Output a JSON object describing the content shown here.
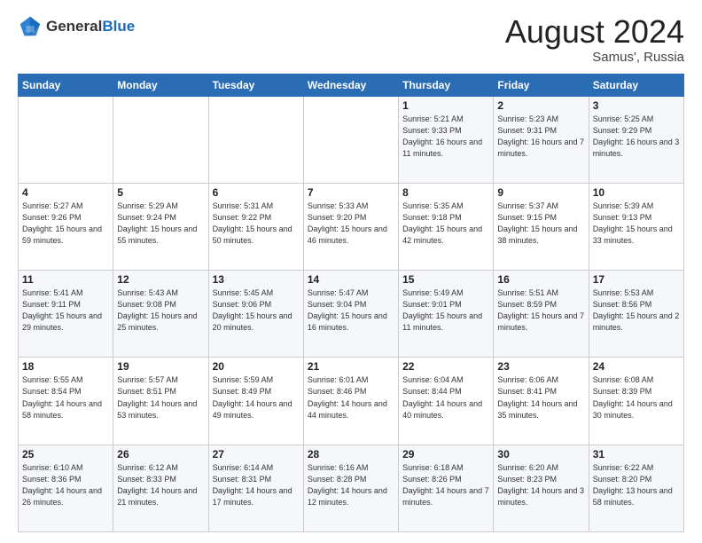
{
  "header": {
    "logo_general": "General",
    "logo_blue": "Blue",
    "month_year": "August 2024",
    "location": "Samus', Russia"
  },
  "weekdays": [
    "Sunday",
    "Monday",
    "Tuesday",
    "Wednesday",
    "Thursday",
    "Friday",
    "Saturday"
  ],
  "weeks": [
    [
      {
        "day": "",
        "sunrise": "",
        "sunset": "",
        "daylight": ""
      },
      {
        "day": "",
        "sunrise": "",
        "sunset": "",
        "daylight": ""
      },
      {
        "day": "",
        "sunrise": "",
        "sunset": "",
        "daylight": ""
      },
      {
        "day": "",
        "sunrise": "",
        "sunset": "",
        "daylight": ""
      },
      {
        "day": "1",
        "sunrise": "Sunrise: 5:21 AM",
        "sunset": "Sunset: 9:33 PM",
        "daylight": "Daylight: 16 hours and 11 minutes."
      },
      {
        "day": "2",
        "sunrise": "Sunrise: 5:23 AM",
        "sunset": "Sunset: 9:31 PM",
        "daylight": "Daylight: 16 hours and 7 minutes."
      },
      {
        "day": "3",
        "sunrise": "Sunrise: 5:25 AM",
        "sunset": "Sunset: 9:29 PM",
        "daylight": "Daylight: 16 hours and 3 minutes."
      }
    ],
    [
      {
        "day": "4",
        "sunrise": "Sunrise: 5:27 AM",
        "sunset": "Sunset: 9:26 PM",
        "daylight": "Daylight: 15 hours and 59 minutes."
      },
      {
        "day": "5",
        "sunrise": "Sunrise: 5:29 AM",
        "sunset": "Sunset: 9:24 PM",
        "daylight": "Daylight: 15 hours and 55 minutes."
      },
      {
        "day": "6",
        "sunrise": "Sunrise: 5:31 AM",
        "sunset": "Sunset: 9:22 PM",
        "daylight": "Daylight: 15 hours and 50 minutes."
      },
      {
        "day": "7",
        "sunrise": "Sunrise: 5:33 AM",
        "sunset": "Sunset: 9:20 PM",
        "daylight": "Daylight: 15 hours and 46 minutes."
      },
      {
        "day": "8",
        "sunrise": "Sunrise: 5:35 AM",
        "sunset": "Sunset: 9:18 PM",
        "daylight": "Daylight: 15 hours and 42 minutes."
      },
      {
        "day": "9",
        "sunrise": "Sunrise: 5:37 AM",
        "sunset": "Sunset: 9:15 PM",
        "daylight": "Daylight: 15 hours and 38 minutes."
      },
      {
        "day": "10",
        "sunrise": "Sunrise: 5:39 AM",
        "sunset": "Sunset: 9:13 PM",
        "daylight": "Daylight: 15 hours and 33 minutes."
      }
    ],
    [
      {
        "day": "11",
        "sunrise": "Sunrise: 5:41 AM",
        "sunset": "Sunset: 9:11 PM",
        "daylight": "Daylight: 15 hours and 29 minutes."
      },
      {
        "day": "12",
        "sunrise": "Sunrise: 5:43 AM",
        "sunset": "Sunset: 9:08 PM",
        "daylight": "Daylight: 15 hours and 25 minutes."
      },
      {
        "day": "13",
        "sunrise": "Sunrise: 5:45 AM",
        "sunset": "Sunset: 9:06 PM",
        "daylight": "Daylight: 15 hours and 20 minutes."
      },
      {
        "day": "14",
        "sunrise": "Sunrise: 5:47 AM",
        "sunset": "Sunset: 9:04 PM",
        "daylight": "Daylight: 15 hours and 16 minutes."
      },
      {
        "day": "15",
        "sunrise": "Sunrise: 5:49 AM",
        "sunset": "Sunset: 9:01 PM",
        "daylight": "Daylight: 15 hours and 11 minutes."
      },
      {
        "day": "16",
        "sunrise": "Sunrise: 5:51 AM",
        "sunset": "Sunset: 8:59 PM",
        "daylight": "Daylight: 15 hours and 7 minutes."
      },
      {
        "day": "17",
        "sunrise": "Sunrise: 5:53 AM",
        "sunset": "Sunset: 8:56 PM",
        "daylight": "Daylight: 15 hours and 2 minutes."
      }
    ],
    [
      {
        "day": "18",
        "sunrise": "Sunrise: 5:55 AM",
        "sunset": "Sunset: 8:54 PM",
        "daylight": "Daylight: 14 hours and 58 minutes."
      },
      {
        "day": "19",
        "sunrise": "Sunrise: 5:57 AM",
        "sunset": "Sunset: 8:51 PM",
        "daylight": "Daylight: 14 hours and 53 minutes."
      },
      {
        "day": "20",
        "sunrise": "Sunrise: 5:59 AM",
        "sunset": "Sunset: 8:49 PM",
        "daylight": "Daylight: 14 hours and 49 minutes."
      },
      {
        "day": "21",
        "sunrise": "Sunrise: 6:01 AM",
        "sunset": "Sunset: 8:46 PM",
        "daylight": "Daylight: 14 hours and 44 minutes."
      },
      {
        "day": "22",
        "sunrise": "Sunrise: 6:04 AM",
        "sunset": "Sunset: 8:44 PM",
        "daylight": "Daylight: 14 hours and 40 minutes."
      },
      {
        "day": "23",
        "sunrise": "Sunrise: 6:06 AM",
        "sunset": "Sunset: 8:41 PM",
        "daylight": "Daylight: 14 hours and 35 minutes."
      },
      {
        "day": "24",
        "sunrise": "Sunrise: 6:08 AM",
        "sunset": "Sunset: 8:39 PM",
        "daylight": "Daylight: 14 hours and 30 minutes."
      }
    ],
    [
      {
        "day": "25",
        "sunrise": "Sunrise: 6:10 AM",
        "sunset": "Sunset: 8:36 PM",
        "daylight": "Daylight: 14 hours and 26 minutes."
      },
      {
        "day": "26",
        "sunrise": "Sunrise: 6:12 AM",
        "sunset": "Sunset: 8:33 PM",
        "daylight": "Daylight: 14 hours and 21 minutes."
      },
      {
        "day": "27",
        "sunrise": "Sunrise: 6:14 AM",
        "sunset": "Sunset: 8:31 PM",
        "daylight": "Daylight: 14 hours and 17 minutes."
      },
      {
        "day": "28",
        "sunrise": "Sunrise: 6:16 AM",
        "sunset": "Sunset: 8:28 PM",
        "daylight": "Daylight: 14 hours and 12 minutes."
      },
      {
        "day": "29",
        "sunrise": "Sunrise: 6:18 AM",
        "sunset": "Sunset: 8:26 PM",
        "daylight": "Daylight: 14 hours and 7 minutes."
      },
      {
        "day": "30",
        "sunrise": "Sunrise: 6:20 AM",
        "sunset": "Sunset: 8:23 PM",
        "daylight": "Daylight: 14 hours and 3 minutes."
      },
      {
        "day": "31",
        "sunrise": "Sunrise: 6:22 AM",
        "sunset": "Sunset: 8:20 PM",
        "daylight": "Daylight: 13 hours and 58 minutes."
      }
    ]
  ]
}
